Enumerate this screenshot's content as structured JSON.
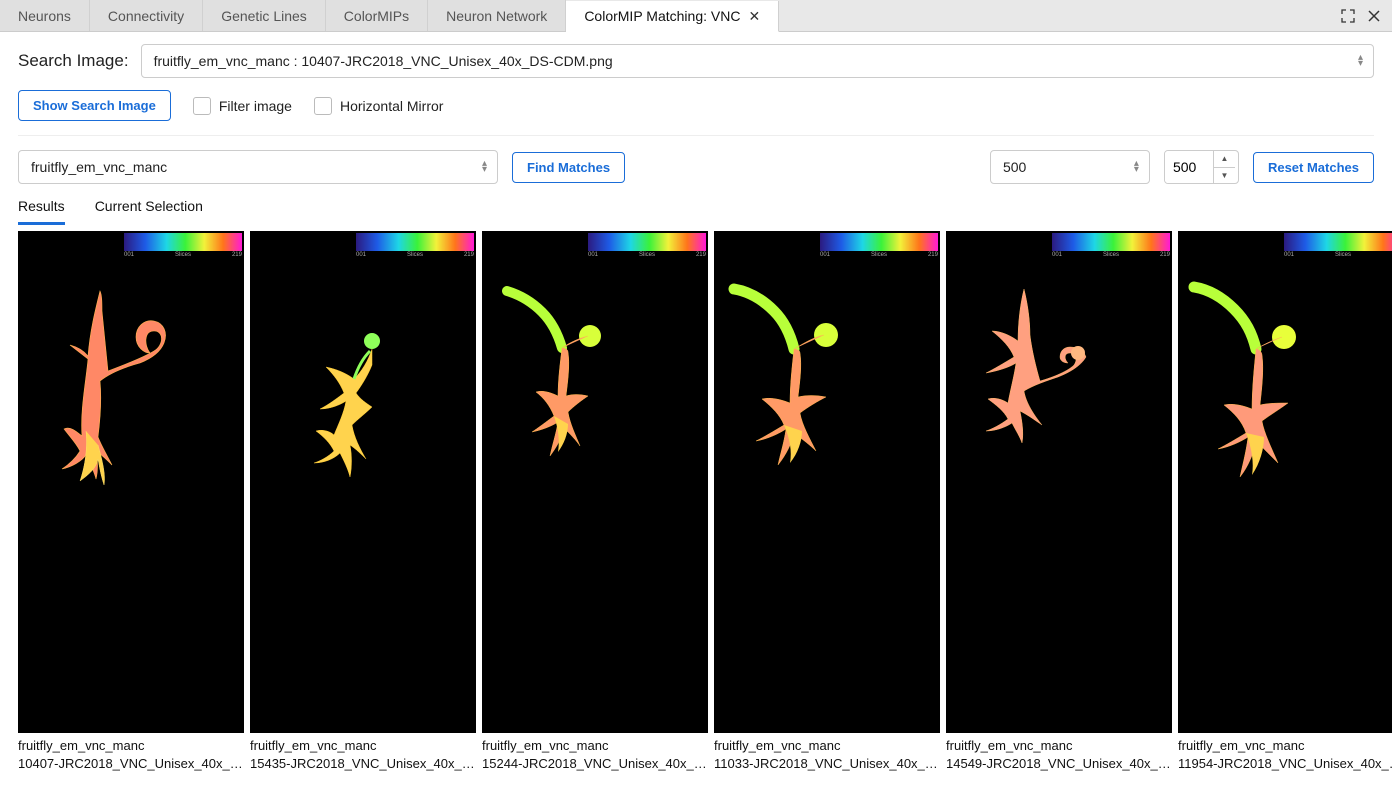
{
  "tabs": [
    {
      "label": "Neurons"
    },
    {
      "label": "Connectivity"
    },
    {
      "label": "Genetic Lines"
    },
    {
      "label": "ColorMIPs"
    },
    {
      "label": "Neuron Network"
    },
    {
      "label": "ColorMIP Matching: VNC",
      "active": true,
      "closable": true
    }
  ],
  "search": {
    "label": "Search Image:",
    "value": "fruitfly_em_vnc_manc  :  10407-JRC2018_VNC_Unisex_40x_DS-CDM.png"
  },
  "buttons": {
    "show_search": "Show Search Image",
    "filter_label": "Filter image",
    "mirror_label": "Horizontal Mirror",
    "find_matches": "Find Matches",
    "reset_matches": "Reset Matches"
  },
  "dataset_select": "fruitfly_em_vnc_manc",
  "limit_select": "500",
  "spinner_value": "500",
  "sub_tabs": {
    "results": "Results",
    "selection": "Current Selection"
  },
  "colorbar": {
    "left": "001",
    "mid": "Slices",
    "right": "219"
  },
  "results": [
    {
      "dataset": "fruitfly_em_vnc_manc",
      "file": "10407-JRC2018_VNC_Unisex_40x_D..."
    },
    {
      "dataset": "fruitfly_em_vnc_manc",
      "file": "15435-JRC2018_VNC_Unisex_40x_D..."
    },
    {
      "dataset": "fruitfly_em_vnc_manc",
      "file": "15244-JRC2018_VNC_Unisex_40x_D..."
    },
    {
      "dataset": "fruitfly_em_vnc_manc",
      "file": "11033-JRC2018_VNC_Unisex_40x_D..."
    },
    {
      "dataset": "fruitfly_em_vnc_manc",
      "file": "14549-JRC2018_VNC_Unisex_40x_D..."
    },
    {
      "dataset": "fruitfly_em_vnc_manc",
      "file": "11954-JRC2018_VNC_Unisex_40x_D..."
    }
  ]
}
